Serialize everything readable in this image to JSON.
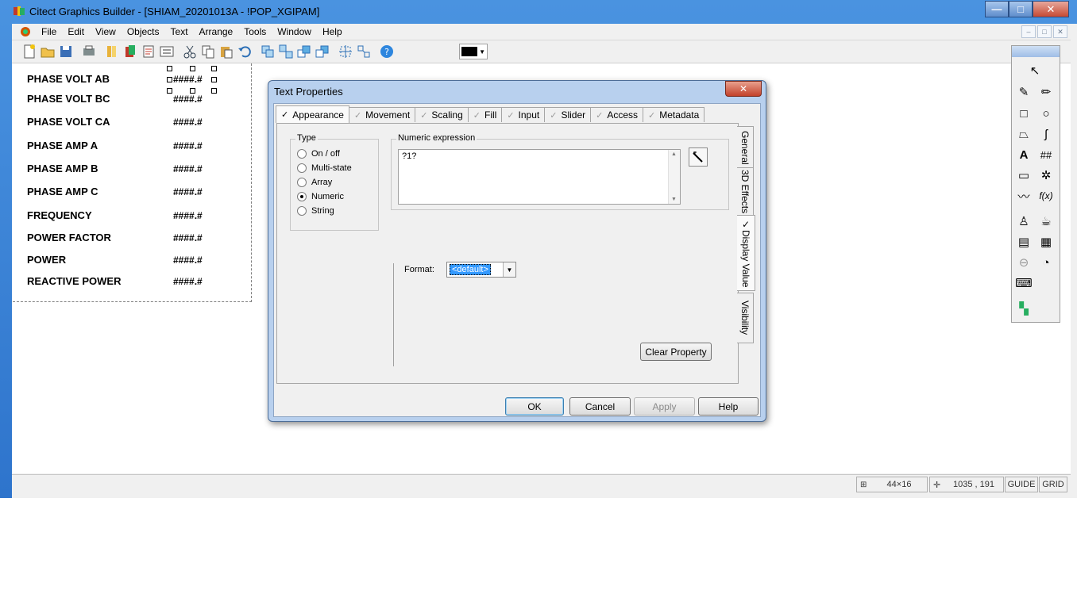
{
  "window": {
    "title": "Citect Graphics Builder - [SHIAM_20201013A - !POP_XGIPAM]",
    "minimize": "—",
    "maximize": "□",
    "close": "✕"
  },
  "menu": {
    "items": [
      "File",
      "Edit",
      "View",
      "Objects",
      "Text",
      "Arrange",
      "Tools",
      "Window",
      "Help"
    ],
    "mdi": [
      "–",
      "□",
      "✕"
    ]
  },
  "toolbar": {
    "icons": [
      "new-icon",
      "open-icon",
      "save-icon",
      "print-icon",
      "library-icon",
      "paste-symbol-icon",
      "properties-icon",
      "tag-list-icon",
      "cut-icon",
      "copy-icon",
      "paste-icon",
      "undo-icon",
      "group-icon",
      "ungroup-icon",
      "bring-forward-icon",
      "send-backward-icon",
      "align-icon",
      "distribute-icon",
      "help-icon"
    ],
    "current_color": "#000000"
  },
  "page": {
    "rows": [
      {
        "label": "PHASE VOLT AB",
        "value": "####.#"
      },
      {
        "label": "PHASE VOLT BC",
        "value": "####.#"
      },
      {
        "label": "PHASE VOLT CA",
        "value": "####.#"
      },
      {
        "label": "PHASE AMP A",
        "value": "####.#"
      },
      {
        "label": "PHASE AMP B",
        "value": "####.#"
      },
      {
        "label": "PHASE AMP C",
        "value": "####.#"
      },
      {
        "label": "FREQUENCY",
        "value": "####.#"
      },
      {
        "label": "POWER FACTOR",
        "value": "####.#"
      },
      {
        "label": "POWER",
        "value": "####.#"
      },
      {
        "label": "REACTIVE POWER",
        "value": "####.#"
      }
    ]
  },
  "status": {
    "size": "44×16",
    "position": "1035 , 191",
    "guide": "GUIDE",
    "grid": "GRID"
  },
  "dialog": {
    "title": "Text Properties",
    "tabs": [
      "Appearance",
      "Movement",
      "Scaling",
      "Fill",
      "Input",
      "Slider",
      "Access",
      "Metadata"
    ],
    "active_tab": "Appearance",
    "side_tabs": [
      "General",
      "3D Effects",
      "Display Value",
      "Visibility"
    ],
    "active_side_tab": "Display Value",
    "type_group": {
      "label": "Type",
      "options": [
        "On / off",
        "Multi-state",
        "Array",
        "Numeric",
        "String"
      ],
      "selected": "Numeric"
    },
    "expression": {
      "label": "Numeric expression",
      "value": "?1?"
    },
    "format": {
      "label": "Format:",
      "value": "<default>"
    },
    "clear_property": "Clear Property",
    "buttons": {
      "ok": "OK",
      "cancel": "Cancel",
      "apply": "Apply",
      "help": "Help"
    }
  },
  "palette": {
    "tools": [
      "pointer-icon",
      "pen-icon",
      "pencil-icon",
      "rectangle-icon",
      "ellipse-icon",
      "polygon-icon",
      "pipe-icon",
      "text-icon",
      "number-icon",
      "button-icon",
      "symbol-set-icon",
      "trend-icon",
      "cicode-icon",
      "stamp-icon",
      "genie-icon",
      "form-icon",
      "table-icon",
      "link-icon",
      "clock-icon",
      "keyboard-icon",
      "mosaic-icon"
    ],
    "text_glyph": "A",
    "number_glyph": "##",
    "fx_glyph": "f(x)"
  }
}
